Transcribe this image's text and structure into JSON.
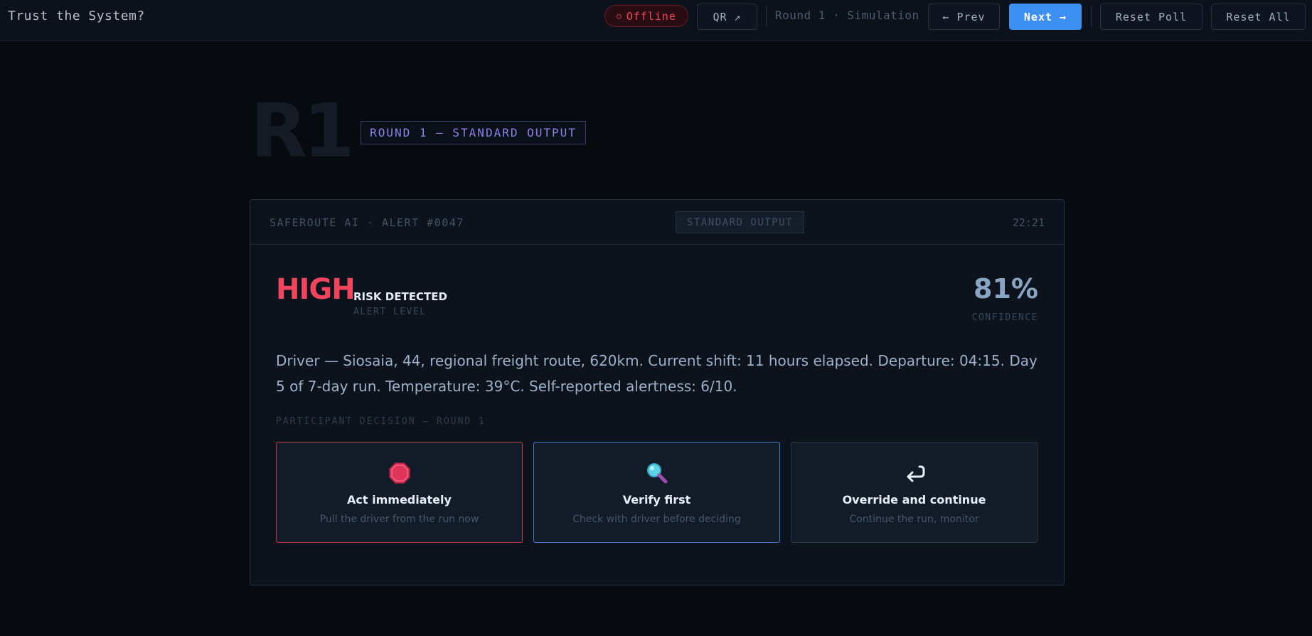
{
  "app": {
    "title": "Trust the System?"
  },
  "toolbar": {
    "status": "Offline",
    "qr_label": "QR ↗",
    "round_label": "Round 1 · Simulation",
    "prev_label": "← Prev",
    "next_label": "Next →",
    "reset_poll_label": "Reset Poll",
    "reset_all_label": "Reset All"
  },
  "hero": {
    "round_code": "R1",
    "round_tag": "ROUND 1 — STANDARD OUTPUT"
  },
  "card": {
    "source": "SAFEROUTE AI · ALERT #0047",
    "badge": "STANDARD OUTPUT",
    "time": "22:21",
    "alert": {
      "level": "HIGH",
      "title": "RISK DETECTED",
      "subtitle": "ALERT LEVEL"
    },
    "confidence": {
      "value": "81%",
      "label": "CONFIDENCE"
    },
    "description": "Driver — Siosaia, 44, regional freight route, 620km. Current shift: 11 hours elapsed. Departure: 04:15. Day 5 of 7-day run. Temperature: 39°C. Self-reported alertness: 6/10.",
    "decision_label": "PARTICIPANT DECISION — ROUND 1",
    "options": [
      {
        "icon": "stop-sign-icon",
        "title": "Act immediately",
        "subtitle": "Pull the driver from the run now"
      },
      {
        "icon": "magnifier-icon",
        "title": "Verify first",
        "subtitle": "Check with driver before deciding"
      },
      {
        "icon": "return-arrow-icon",
        "title": "Override and continue",
        "subtitle": "Continue the run, monitor"
      }
    ]
  },
  "colors": {
    "accent": "#3d8ff2",
    "danger": "#f0455c",
    "violet": "#8b84e8",
    "background": "#070b10"
  }
}
